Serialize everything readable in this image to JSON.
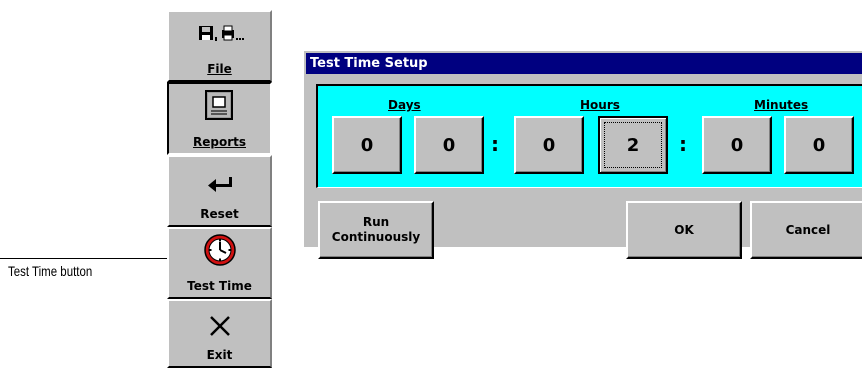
{
  "toolbar": {
    "file_label": "File",
    "reports_label": "Reports",
    "reset_label": "Reset",
    "test_time_label": "Test Time",
    "exit_label": "Exit"
  },
  "callout": {
    "text": "Test Time button"
  },
  "dialog": {
    "title": "Test Time Setup",
    "days_label": "Days",
    "hours_label": "Hours",
    "minutes_label": "Minutes",
    "digits": [
      "0",
      "0",
      "0",
      "2",
      "0",
      "0"
    ],
    "separator": ":",
    "run_continuously_label": "Run\nContinuously",
    "ok_label": "OK",
    "cancel_label": "Cancel"
  },
  "colors": {
    "title_bar": "#000080",
    "time_panel": "#00ffff",
    "face": "#c0c0c0"
  }
}
